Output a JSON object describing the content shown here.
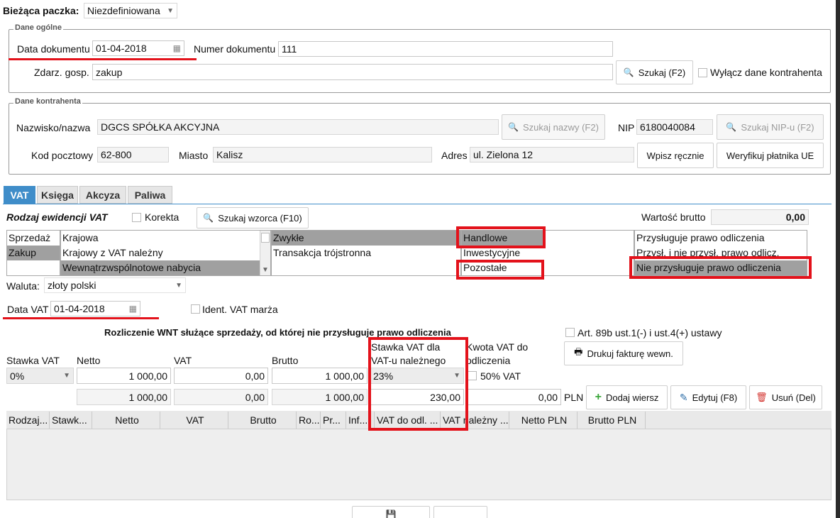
{
  "batch": {
    "label": "Bieżąca paczka:",
    "value": "Niezdefiniowana"
  },
  "general": {
    "title": "Dane ogólne",
    "doc_date_label": "Data dokumentu",
    "doc_date": "01-04-2018",
    "doc_number_label": "Numer dokumentu",
    "doc_number": "111",
    "event_label": "Zdarz. gosp.",
    "event": "zakup",
    "search_button": "Szukaj (F2)",
    "disable_contractor_label": "Wyłącz dane kontrahenta"
  },
  "contractor": {
    "title": "Dane kontrahenta",
    "name_label": "Nazwisko/nazwa",
    "name": "DGCS SPÓŁKA AKCYJNA",
    "search_name_button": "Szukaj nazwy (F2)",
    "nip_label": "NIP",
    "nip": "6180040084",
    "search_nip_button": "Szukaj NIP-u (F2)",
    "postal_label": "Kod pocztowy",
    "postal": "62-800",
    "city_label": "Miasto",
    "city": "Kalisz",
    "address_label": "Adres",
    "address": "ul. Zielona 12",
    "manual_button": "Wpisz ręcznie",
    "verify_button": "Weryfikuj płatnika UE"
  },
  "tabs": [
    "VAT",
    "Księga",
    "Akcyza",
    "Paliwa"
  ],
  "vat": {
    "register_label": "Rodzaj ewidencji VAT",
    "correction_label": "Korekta",
    "template_button": "Szukaj wzorca (F10)",
    "gross_label": "Wartość brutto",
    "gross_value": "0,00",
    "list1": [
      "Sprzedaż",
      "Zakup"
    ],
    "list2": [
      "Krajowa",
      "Krajowy z VAT należny",
      "Wewnątrzwspólnotowe nabycia"
    ],
    "list3": [
      "Zwykłe",
      "Transakcja trójstronna"
    ],
    "list4": [
      "Handlowe",
      "Inwestycyjne",
      "Pozostałe"
    ],
    "list5": [
      "Przysługuje prawo odliczenia",
      "Przysł. i nie przysł. prawo odlicz.",
      "Nie przysługuje prawo odliczenia"
    ],
    "currency_label": "Waluta:",
    "currency": "złoty polski",
    "vat_date_label": "Data VAT",
    "vat_date": "01-04-2018",
    "ident_label": "Ident. VAT marża",
    "wnt_title": "Rozliczenie WNT służące sprzedaży, od której nie przysługuje prawo odliczenia",
    "art_label": "Art. 89b ust.1(-) i ust.4(+) ustawy",
    "print_button": "Drukuj fakturę wewn.",
    "col_rate": "Stawka VAT",
    "col_net": "Netto",
    "col_vat": "VAT",
    "col_gross": "Brutto",
    "col_rate_due_1": "Stawka VAT dla",
    "col_rate_due_2": "VAT-u należnego",
    "col_deduct_1": "Kwota VAT do",
    "col_deduct_2": "odliczenia",
    "rate": "0%",
    "net": "1 000,00",
    "vat_amount": "0,00",
    "gross": "1 000,00",
    "rate_due": "23%",
    "half_vat_label": "50% VAT",
    "net2": "1 000,00",
    "vat2": "0,00",
    "gross2": "1 000,00",
    "due2": "230,00",
    "deduct2": "0,00",
    "currency_code": "PLN",
    "add_button": "Dodaj wiersz",
    "edit_button": "Edytuj (F8)",
    "delete_button": "Usuń (Del)"
  },
  "table": {
    "headers": [
      "Rodzaj...",
      "Stawk...",
      "Netto",
      "VAT",
      "Brutto",
      "Ro...",
      "Pr...",
      "Inf...",
      "VAT do odl. ...",
      "VAT należny ...",
      "Netto PLN",
      "Brutto PLN"
    ]
  }
}
